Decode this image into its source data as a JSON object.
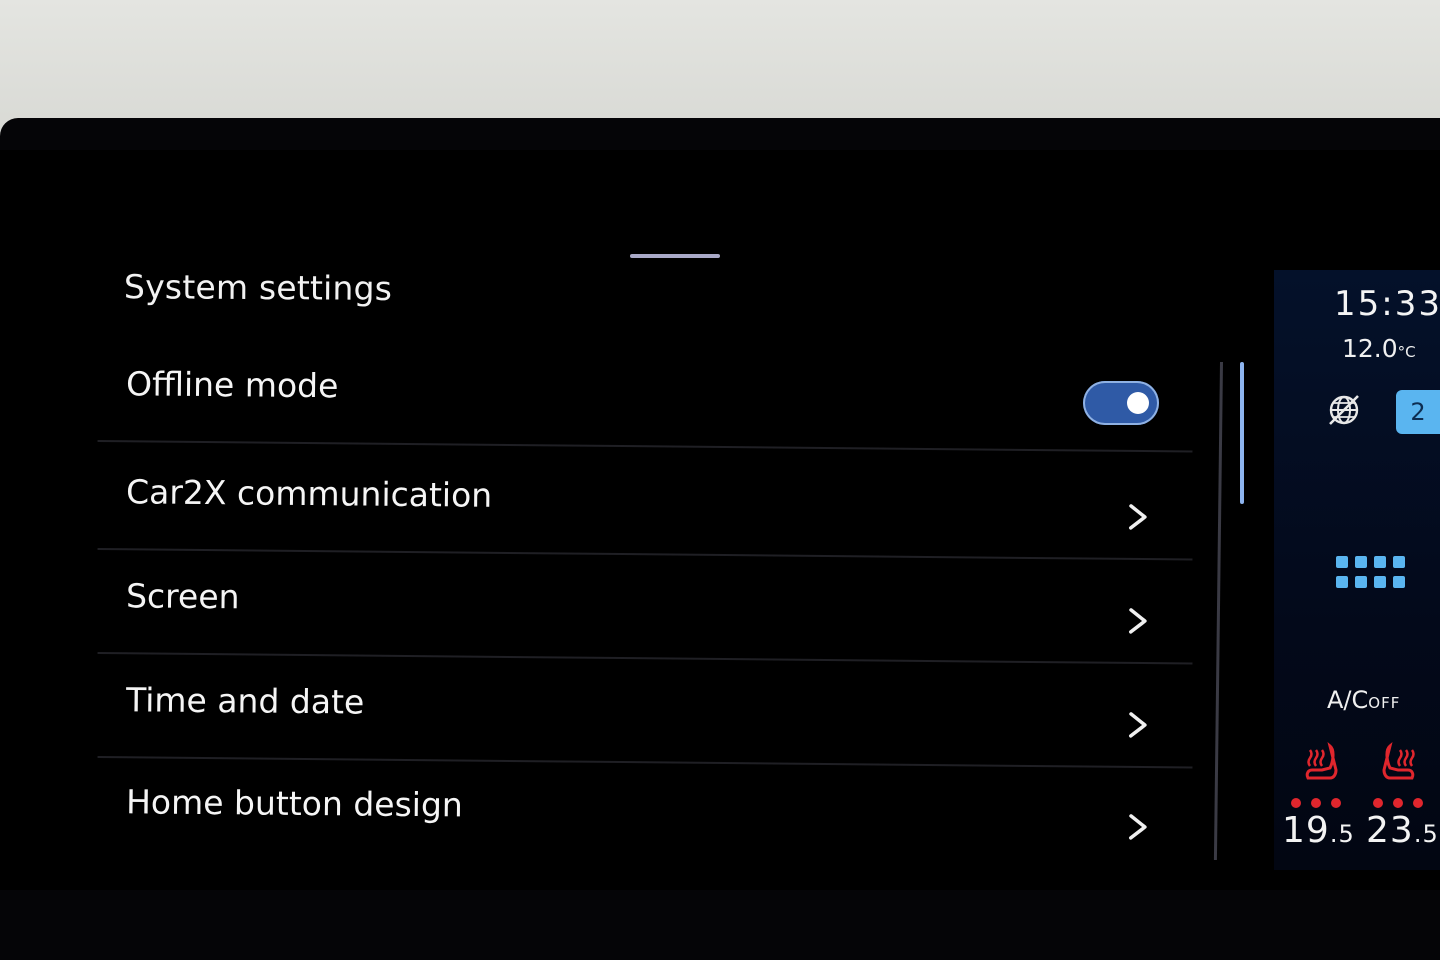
{
  "header": {
    "title": "System settings"
  },
  "settings": [
    {
      "label": "Offline mode",
      "control": "toggle",
      "enabled": true
    },
    {
      "label": "Car2X communication",
      "control": "chevron-right-icon"
    },
    {
      "label": "Screen",
      "control": "chevron-right-icon"
    },
    {
      "label": "Time and date",
      "control": "chevron-right-icon"
    },
    {
      "label": "Home button design",
      "control": "chevron-right-icon"
    }
  ],
  "status": {
    "time": "15:33",
    "outside_temp_value": "12.0",
    "outside_temp_unit": "°C",
    "badge_count": "2"
  },
  "climate": {
    "ac_label": "A/C",
    "ac_state": "OFF",
    "left_temp_int": "19",
    "left_temp_dec": ".5",
    "right_temp_int": "23",
    "right_temp_dec": ".5",
    "seat_heat_left_level": 3,
    "seat_heat_right_level": 3
  },
  "colors": {
    "accent_toggle": "#2f5aa6",
    "accent_scroll": "#8db4ef",
    "seat_heat": "#e0262d",
    "badge": "#5ab5f0"
  }
}
